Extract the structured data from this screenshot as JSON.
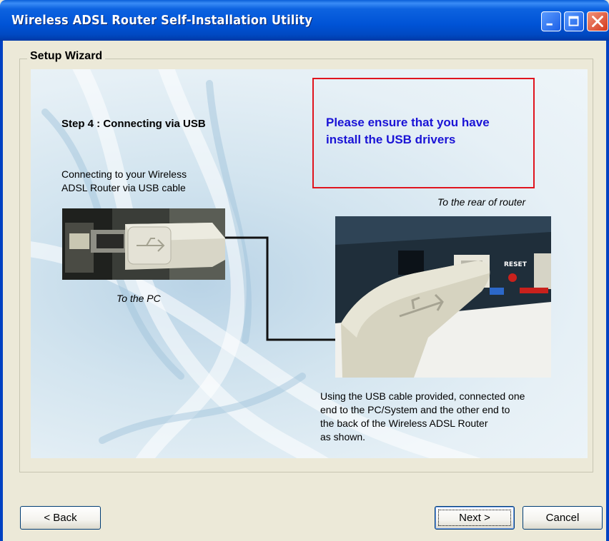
{
  "window": {
    "title": "Wireless ADSL Router Self-Installation Utility",
    "controls": {
      "minimize": "minimize-icon",
      "maximize": "maximize-icon",
      "close": "close-icon"
    }
  },
  "group": {
    "label": "Setup Wizard"
  },
  "content": {
    "step_title": "Step 4 : Connecting via USB",
    "notice_line1": "Please ensure that you have",
    "notice_line2": "install the USB drivers",
    "connect_line1": "Connecting to your Wireless",
    "connect_line2": "ADSL Router via USB cable",
    "rear_label": "To the rear of router",
    "pc_label": "To the PC",
    "instructions_line1": "Using the USB cable provided, connected one",
    "instructions_line2": "end to the PC/System and the other end to",
    "instructions_line3": "the back of the Wireless ADSL Router",
    "instructions_line4": "as shown.",
    "router_port_label": "RESET"
  },
  "buttons": {
    "back": "< Back",
    "next": "Next >",
    "cancel": "Cancel"
  },
  "colors": {
    "notice_text": "#1a13d6",
    "notice_border": "#e0141e",
    "titlebar": "#0053d6"
  }
}
